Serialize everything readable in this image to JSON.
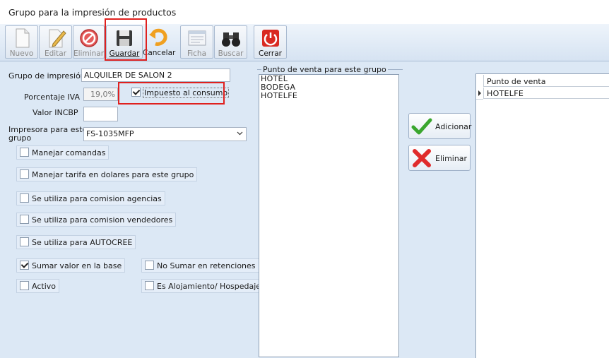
{
  "window": {
    "title": "Grupo para la impresión de productos"
  },
  "toolbar": {
    "nuevo": "Nuevo",
    "editar": "Editar",
    "eliminar": "Eliminar",
    "guardar": "Guardar",
    "cancelar": "Cancelar",
    "ficha": "Ficha",
    "buscar": "Buscar",
    "cerrar": "Cerrar"
  },
  "form": {
    "grupo_label": "Grupo de impresión",
    "grupo_value": "ALQUILER DE SALON 2",
    "porcentaje_label": "Porcentaje IVA",
    "porcentaje_value": "19,0%",
    "impuesto_label": "Impuesto al consumo",
    "impuesto_checked": true,
    "incbp_label": "Valor INCBP",
    "incbp_value": "",
    "impresora_label_1": "Impresora para este",
    "impresora_label_2": "grupo",
    "impresora_value": "FS-1035MFP"
  },
  "options": {
    "manejar_comandas": {
      "label": "Manejar comandas",
      "checked": false
    },
    "manejar_tarifa": {
      "label": "Manejar tarifa en dolares para este grupo",
      "checked": false
    },
    "comision_agencias": {
      "label": "Se utiliza para comision agencias",
      "checked": false
    },
    "comision_vendedores": {
      "label": "Se utiliza para comision vendedores",
      "checked": false
    },
    "autocree": {
      "label": "Se utiliza para AUTOCREE",
      "checked": false
    },
    "sumar_base": {
      "label": "Sumar valor en la base",
      "checked": true
    },
    "no_sumar": {
      "label": "No Sumar en retenciones",
      "checked": false
    },
    "activo": {
      "label": "Activo",
      "checked": false
    },
    "alojamiento": {
      "label": "Es Alojamiento/ Hospedaje",
      "checked": false
    }
  },
  "puntos": {
    "group_title": "Punto de venta para este grupo",
    "available": [
      "HOTEL",
      "BODEGA",
      "HOTELFE"
    ],
    "adicionar": "Adicionar",
    "eliminar": "Eliminar",
    "grid_header": "Punto de venta",
    "selected": [
      "HOTELFE"
    ]
  },
  "colors": {
    "highlight": "#e0201e",
    "background": "#dce8f5"
  }
}
